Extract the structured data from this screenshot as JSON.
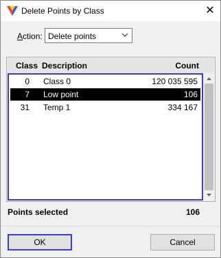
{
  "window": {
    "title": "Delete Points by Class",
    "close_glyph": "✕"
  },
  "action": {
    "label_prefix": "A",
    "label_rest": "ction:",
    "value": "Delete points"
  },
  "table": {
    "headers": {
      "class": "Class",
      "description": "Description",
      "count": "Count"
    },
    "rows": [
      {
        "class": "0",
        "description": "Class 0",
        "count": "120 035 595",
        "selected": false
      },
      {
        "class": "7",
        "description": "Low point",
        "count": "106",
        "selected": true
      },
      {
        "class": "31",
        "description": "Temp 1",
        "count": "334 167",
        "selected": false
      }
    ]
  },
  "summary": {
    "label": "Points selected",
    "value": "106"
  },
  "buttons": {
    "ok": "OK",
    "cancel": "Cancel"
  },
  "colors": {
    "selection": "#000000",
    "focus": "#3a3ad8"
  }
}
